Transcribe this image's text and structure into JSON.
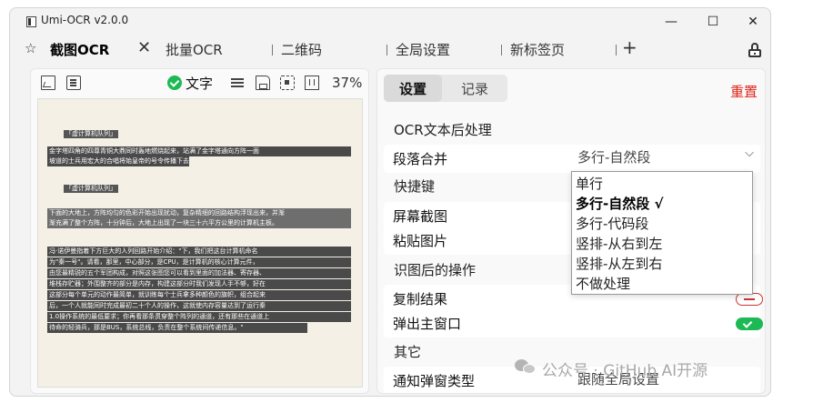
{
  "window": {
    "title": "Umi-OCR v2.0.0",
    "controls": {
      "minimize": "—",
      "maximize": "☐",
      "close": "✕"
    }
  },
  "tabs": {
    "pin": "☆",
    "items": [
      {
        "label": "截图OCR",
        "active": true
      },
      {
        "label": "批量OCR",
        "active": false
      },
      {
        "label": "二维码",
        "active": false
      },
      {
        "label": "全局设置",
        "active": false
      },
      {
        "label": "新标签页",
        "active": false
      }
    ],
    "close": "✕",
    "add": "+"
  },
  "left_panel": {
    "toolbar": {
      "text_toggle": "文字",
      "zoom": "37%"
    },
    "preview": {
      "title1": "「虚计算机队列」",
      "para1": [
        "金字塔四角的四尊青铜大鼎同时轰地燃烧起来，站满了金字塔通向方阵一面",
        "坡道的士兵用宏大的合唱将始皇帝的号令传播下去："
      ],
      "title2": "「虚计算机队列」",
      "para2": [
        "下面的大地上，方阵均匀的色彩开始出现扰动，复杂精细的回路结构浮现出来，并渐",
        "渐充满了整个方阵，十分钟后，大地上出现了一块三十六平方公里的计算机主板。"
      ],
      "para3": [
        "冯·诺伊曼指着下方巨大的人列回路开始介绍：\"下，我们把这台计算机命名",
        "为\"秦一号\"。请看，那里，中心部分，是CPU，是计算机的核心计算元件，",
        "由您最精锐的五个军团构成，对照这张图您可以看到里面的加法器、寄存器、",
        "堆栈存贮器；外围整齐的部分是内存，构建这部分时我们发现人手不够，好在",
        "这部分每个单元的动作最简单，就训练每个士兵拿多种颜色的旗帜，组合起来",
        "后，一个人就能同时完成最初二十个人的操作，这就使内存容量达到了运行秦",
        "1.0操作系统的最低要求；你再看那条贯穿整个阵列的通道，还有那些在通道上",
        "待命的轻骑兵，那是BUS，系统总线，负责在整个系统间传递信息。\""
      ]
    }
  },
  "right_panel": {
    "tabs": [
      {
        "label": "设置",
        "active": true
      },
      {
        "label": "记录",
        "active": false
      }
    ],
    "reset": "重置",
    "sections": {
      "ocr_post": "OCR文本后处理",
      "hotkeys": "快捷键",
      "after_ocr": "识图后的操作",
      "other": "其它"
    },
    "rows": {
      "merge": {
        "label": "段落合并",
        "value": "多行-自然段"
      },
      "screenshot": {
        "label": "屏幕截图"
      },
      "paste": {
        "label": "粘贴图片"
      },
      "copy_result": {
        "label": "复制结果",
        "enabled": false
      },
      "popup_main": {
        "label": "弹出主窗口",
        "enabled": true
      },
      "notify_type": {
        "label": "通知弹窗类型",
        "value": "跟随全局设置"
      }
    },
    "dropdown": {
      "options": [
        {
          "label": "单行",
          "selected": false
        },
        {
          "label": "多行-自然段 √",
          "selected": true
        },
        {
          "label": "多行-代码段",
          "selected": false
        },
        {
          "label": "竖排-从右到左",
          "selected": false
        },
        {
          "label": "竖排-从左到右",
          "selected": false
        },
        {
          "label": "不做处理",
          "selected": false
        }
      ]
    }
  },
  "watermark": "公众号 · GitHub AI开源",
  "colors": {
    "accent_green": "#1db954",
    "reset_red": "#e0261b"
  }
}
